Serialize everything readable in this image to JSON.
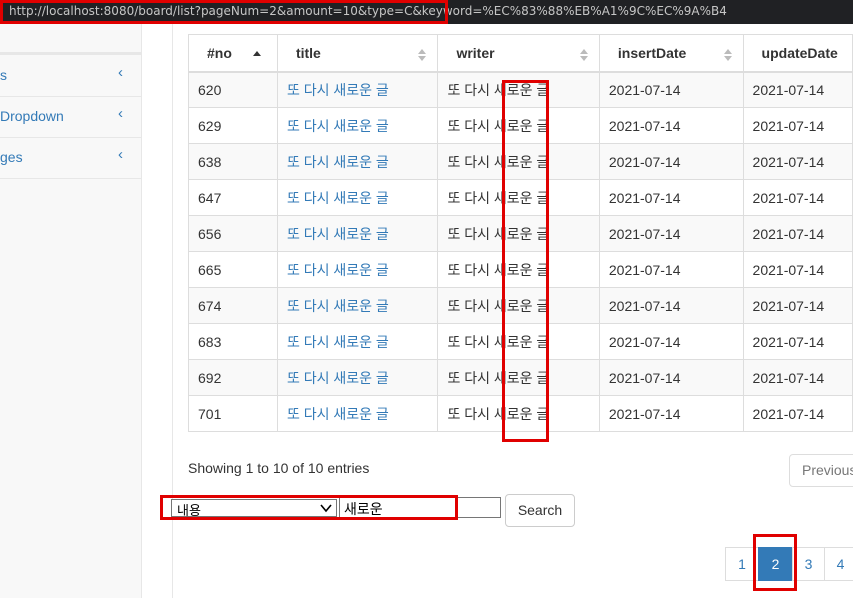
{
  "browser": {
    "url": "http://localhost:8080/board/list?pageNum=2&amount=10&type=C&keyword=%EC%83%88%EB%A1%9C%EC%9A%B4"
  },
  "sidebar": {
    "items": [
      {
        "label": "s",
        "icon": "chevron-left-icon"
      },
      {
        "label": "Dropdown",
        "icon": "chevron-left-icon"
      },
      {
        "label": "ges",
        "icon": "chevron-left-icon"
      }
    ]
  },
  "table": {
    "headers": [
      "#no",
      "title",
      "writer",
      "insertDate",
      "updateDate"
    ],
    "rows": [
      {
        "no": "620",
        "title": "또 다시 새로운 글",
        "writer": "또 다시 새로운 글",
        "insertDate": "2021-07-14",
        "updateDate": "2021-07-14"
      },
      {
        "no": "629",
        "title": "또 다시 새로운 글",
        "writer": "또 다시 새로운 글",
        "insertDate": "2021-07-14",
        "updateDate": "2021-07-14"
      },
      {
        "no": "638",
        "title": "또 다시 새로운 글",
        "writer": "또 다시 새로운 글",
        "insertDate": "2021-07-14",
        "updateDate": "2021-07-14"
      },
      {
        "no": "647",
        "title": "또 다시 새로운 글",
        "writer": "또 다시 새로운 글",
        "insertDate": "2021-07-14",
        "updateDate": "2021-07-14"
      },
      {
        "no": "656",
        "title": "또 다시 새로운 글",
        "writer": "또 다시 새로운 글",
        "insertDate": "2021-07-14",
        "updateDate": "2021-07-14"
      },
      {
        "no": "665",
        "title": "또 다시 새로운 글",
        "writer": "또 다시 새로운 글",
        "insertDate": "2021-07-14",
        "updateDate": "2021-07-14"
      },
      {
        "no": "674",
        "title": "또 다시 새로운 글",
        "writer": "또 다시 새로운 글",
        "insertDate": "2021-07-14",
        "updateDate": "2021-07-14"
      },
      {
        "no": "683",
        "title": "또 다시 새로운 글",
        "writer": "또 다시 새로운 글",
        "insertDate": "2021-07-14",
        "updateDate": "2021-07-14"
      },
      {
        "no": "692",
        "title": "또 다시 새로운 글",
        "writer": "또 다시 새로운 글",
        "insertDate": "2021-07-14",
        "updateDate": "2021-07-14"
      },
      {
        "no": "701",
        "title": "또 다시 새로운 글",
        "writer": "또 다시 새로운 글",
        "insertDate": "2021-07-14",
        "updateDate": "2021-07-14"
      }
    ]
  },
  "info": {
    "text": "Showing 1 to 10 of 10 entries"
  },
  "pagination_top": {
    "previous": "Previous"
  },
  "search": {
    "type_selected": "내용",
    "keyword": "새로운",
    "button": "Search"
  },
  "pagination": {
    "pages": [
      "1",
      "2",
      "3",
      "4"
    ],
    "active": "2"
  },
  "colors": {
    "link": "#337ab7",
    "highlight": "#e00000",
    "urlbar": "#202124"
  }
}
